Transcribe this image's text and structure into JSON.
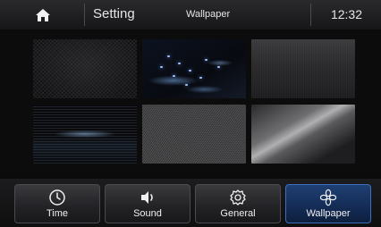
{
  "header": {
    "home_icon": "home-icon",
    "title": "Setting",
    "subtitle": "Wallpaper",
    "clock": "12:32"
  },
  "wallpapers": [
    {
      "name": "dark-mesh"
    },
    {
      "name": "blue-light-streaks"
    },
    {
      "name": "brushed-steel"
    },
    {
      "name": "blue-horizon"
    },
    {
      "name": "grey-noise"
    },
    {
      "name": "silver-sheen"
    }
  ],
  "tabs": [
    {
      "label": "Time",
      "icon": "clock-icon"
    },
    {
      "label": "Sound",
      "icon": "speaker-icon"
    },
    {
      "label": "General",
      "icon": "gear-icon"
    },
    {
      "label": "Wallpaper",
      "icon": "flower-icon",
      "active": true
    }
  ],
  "colors": {
    "accent": "#1f3f73",
    "background": "#0b0b0c"
  }
}
